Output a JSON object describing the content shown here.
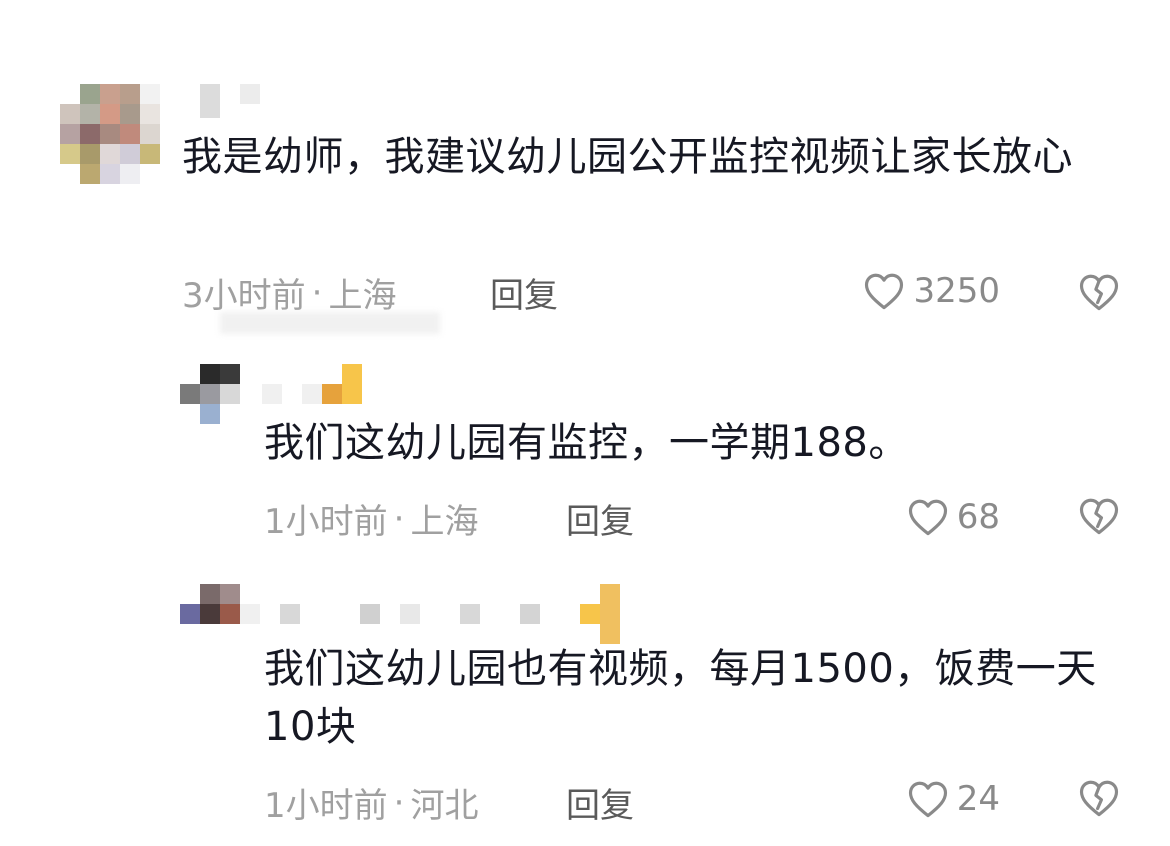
{
  "comments": [
    {
      "text": "我是幼师，我建议幼儿园公开监控视频让家长放心",
      "time": "3小时前",
      "location": "上海",
      "reply_label": "回复",
      "likes": "3250"
    },
    {
      "text": "我们这幼儿园有监控，一学期188。",
      "time": "1小时前",
      "location": "上海",
      "reply_label": "回复",
      "likes": "68"
    },
    {
      "text": "我们这幼儿园也有视频，每月1500，饭费一天10块",
      "time": "1小时前",
      "location": "河北",
      "reply_label": "回复",
      "likes": "24"
    }
  ],
  "meta_separator": "·",
  "icons": {
    "like": "heart-outline-icon",
    "dislike": "broken-heart-icon"
  },
  "colors": {
    "text": "#161823",
    "meta": "#a0a0a0",
    "reply": "#5a5a5a",
    "icon": "#8a8a8a"
  }
}
